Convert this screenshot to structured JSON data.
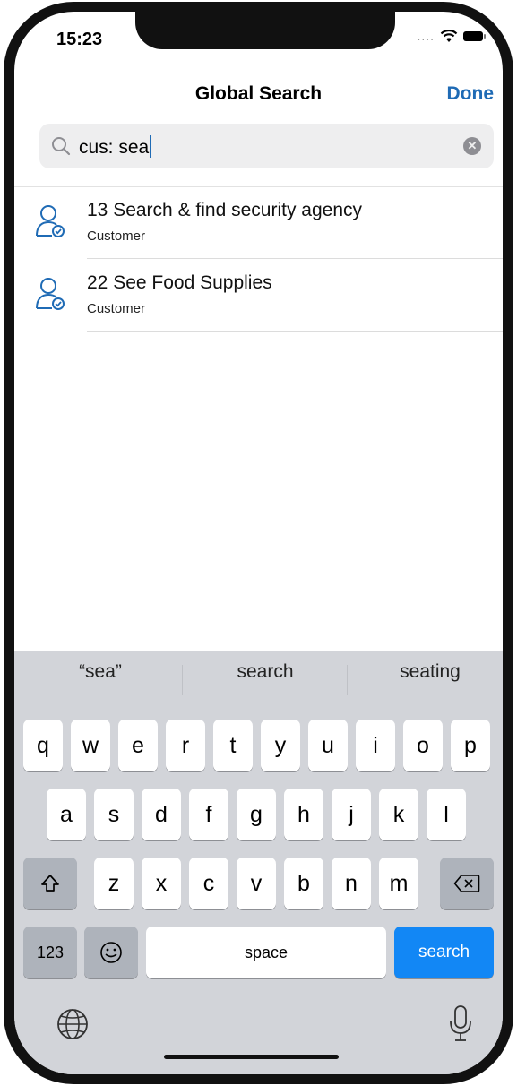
{
  "status_bar": {
    "time": "15:23",
    "signal": "...."
  },
  "nav": {
    "title": "Global Search",
    "done_label": "Done"
  },
  "search": {
    "query": "cus: sea"
  },
  "results": [
    {
      "title": "13 Search & find security agency",
      "subtitle": "Customer",
      "icon": "customer-icon"
    },
    {
      "title": "22 See Food Supplies",
      "subtitle": "Customer",
      "icon": "customer-icon"
    }
  ],
  "keyboard": {
    "suggestions": [
      "“sea”",
      "search",
      "seating"
    ],
    "row1": [
      "q",
      "w",
      "e",
      "r",
      "t",
      "y",
      "u",
      "i",
      "o",
      "p"
    ],
    "row2": [
      "a",
      "s",
      "d",
      "f",
      "g",
      "h",
      "j",
      "k",
      "l"
    ],
    "row3": [
      "z",
      "x",
      "c",
      "v",
      "b",
      "n",
      "m"
    ],
    "numbers_label": "123",
    "space_label": "space",
    "search_label": "search"
  },
  "colors": {
    "accent": "#1f6bb5",
    "search_key": "#1287f5",
    "keyboard_bg": "#d2d4d9"
  }
}
